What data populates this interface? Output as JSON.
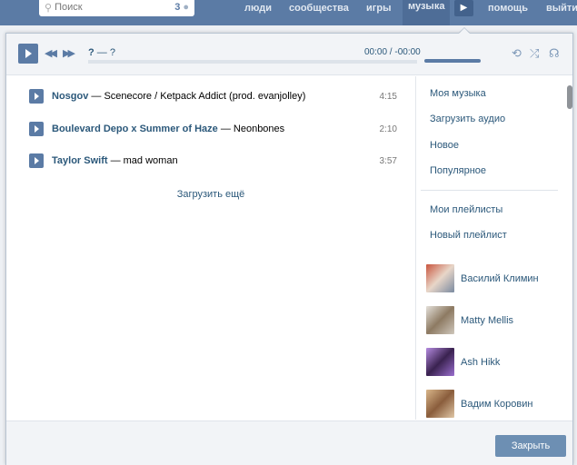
{
  "topbar": {
    "search_placeholder": "Поиск",
    "search_count": "3",
    "nav": [
      "люди",
      "сообщества",
      "игры",
      "музыка",
      "помощь",
      "выйти"
    ]
  },
  "player": {
    "title_artist": "?",
    "title_sep": " — ",
    "title_song": "?",
    "time": "00:00 / -00:00",
    "volume_percent": 95,
    "progress_percent": 0
  },
  "tracks": [
    {
      "artist": "Nosgov",
      "title": " — Scenecore / Ketpack Addict (prod. evanjolley)",
      "duration": "4:15"
    },
    {
      "artist": "Boulevard Depo x Summer of Haze",
      "title": " — Neonbones",
      "duration": "2:10"
    },
    {
      "artist": "Taylor Swift",
      "title": " — mad woman",
      "duration": "3:57"
    }
  ],
  "load_more": "Загрузить ещё",
  "sidebar": {
    "items": [
      "Моя музыка",
      "Загрузить аудио",
      "Новое",
      "Популярное"
    ],
    "playlists": [
      "Мои плейлисты",
      "Новый плейлист"
    ],
    "friends": [
      "Василий Климин",
      "Matty Mellis",
      "Ash Hikk",
      "Вадим Коровин"
    ]
  },
  "footer": {
    "close_label": "Закрыть"
  }
}
